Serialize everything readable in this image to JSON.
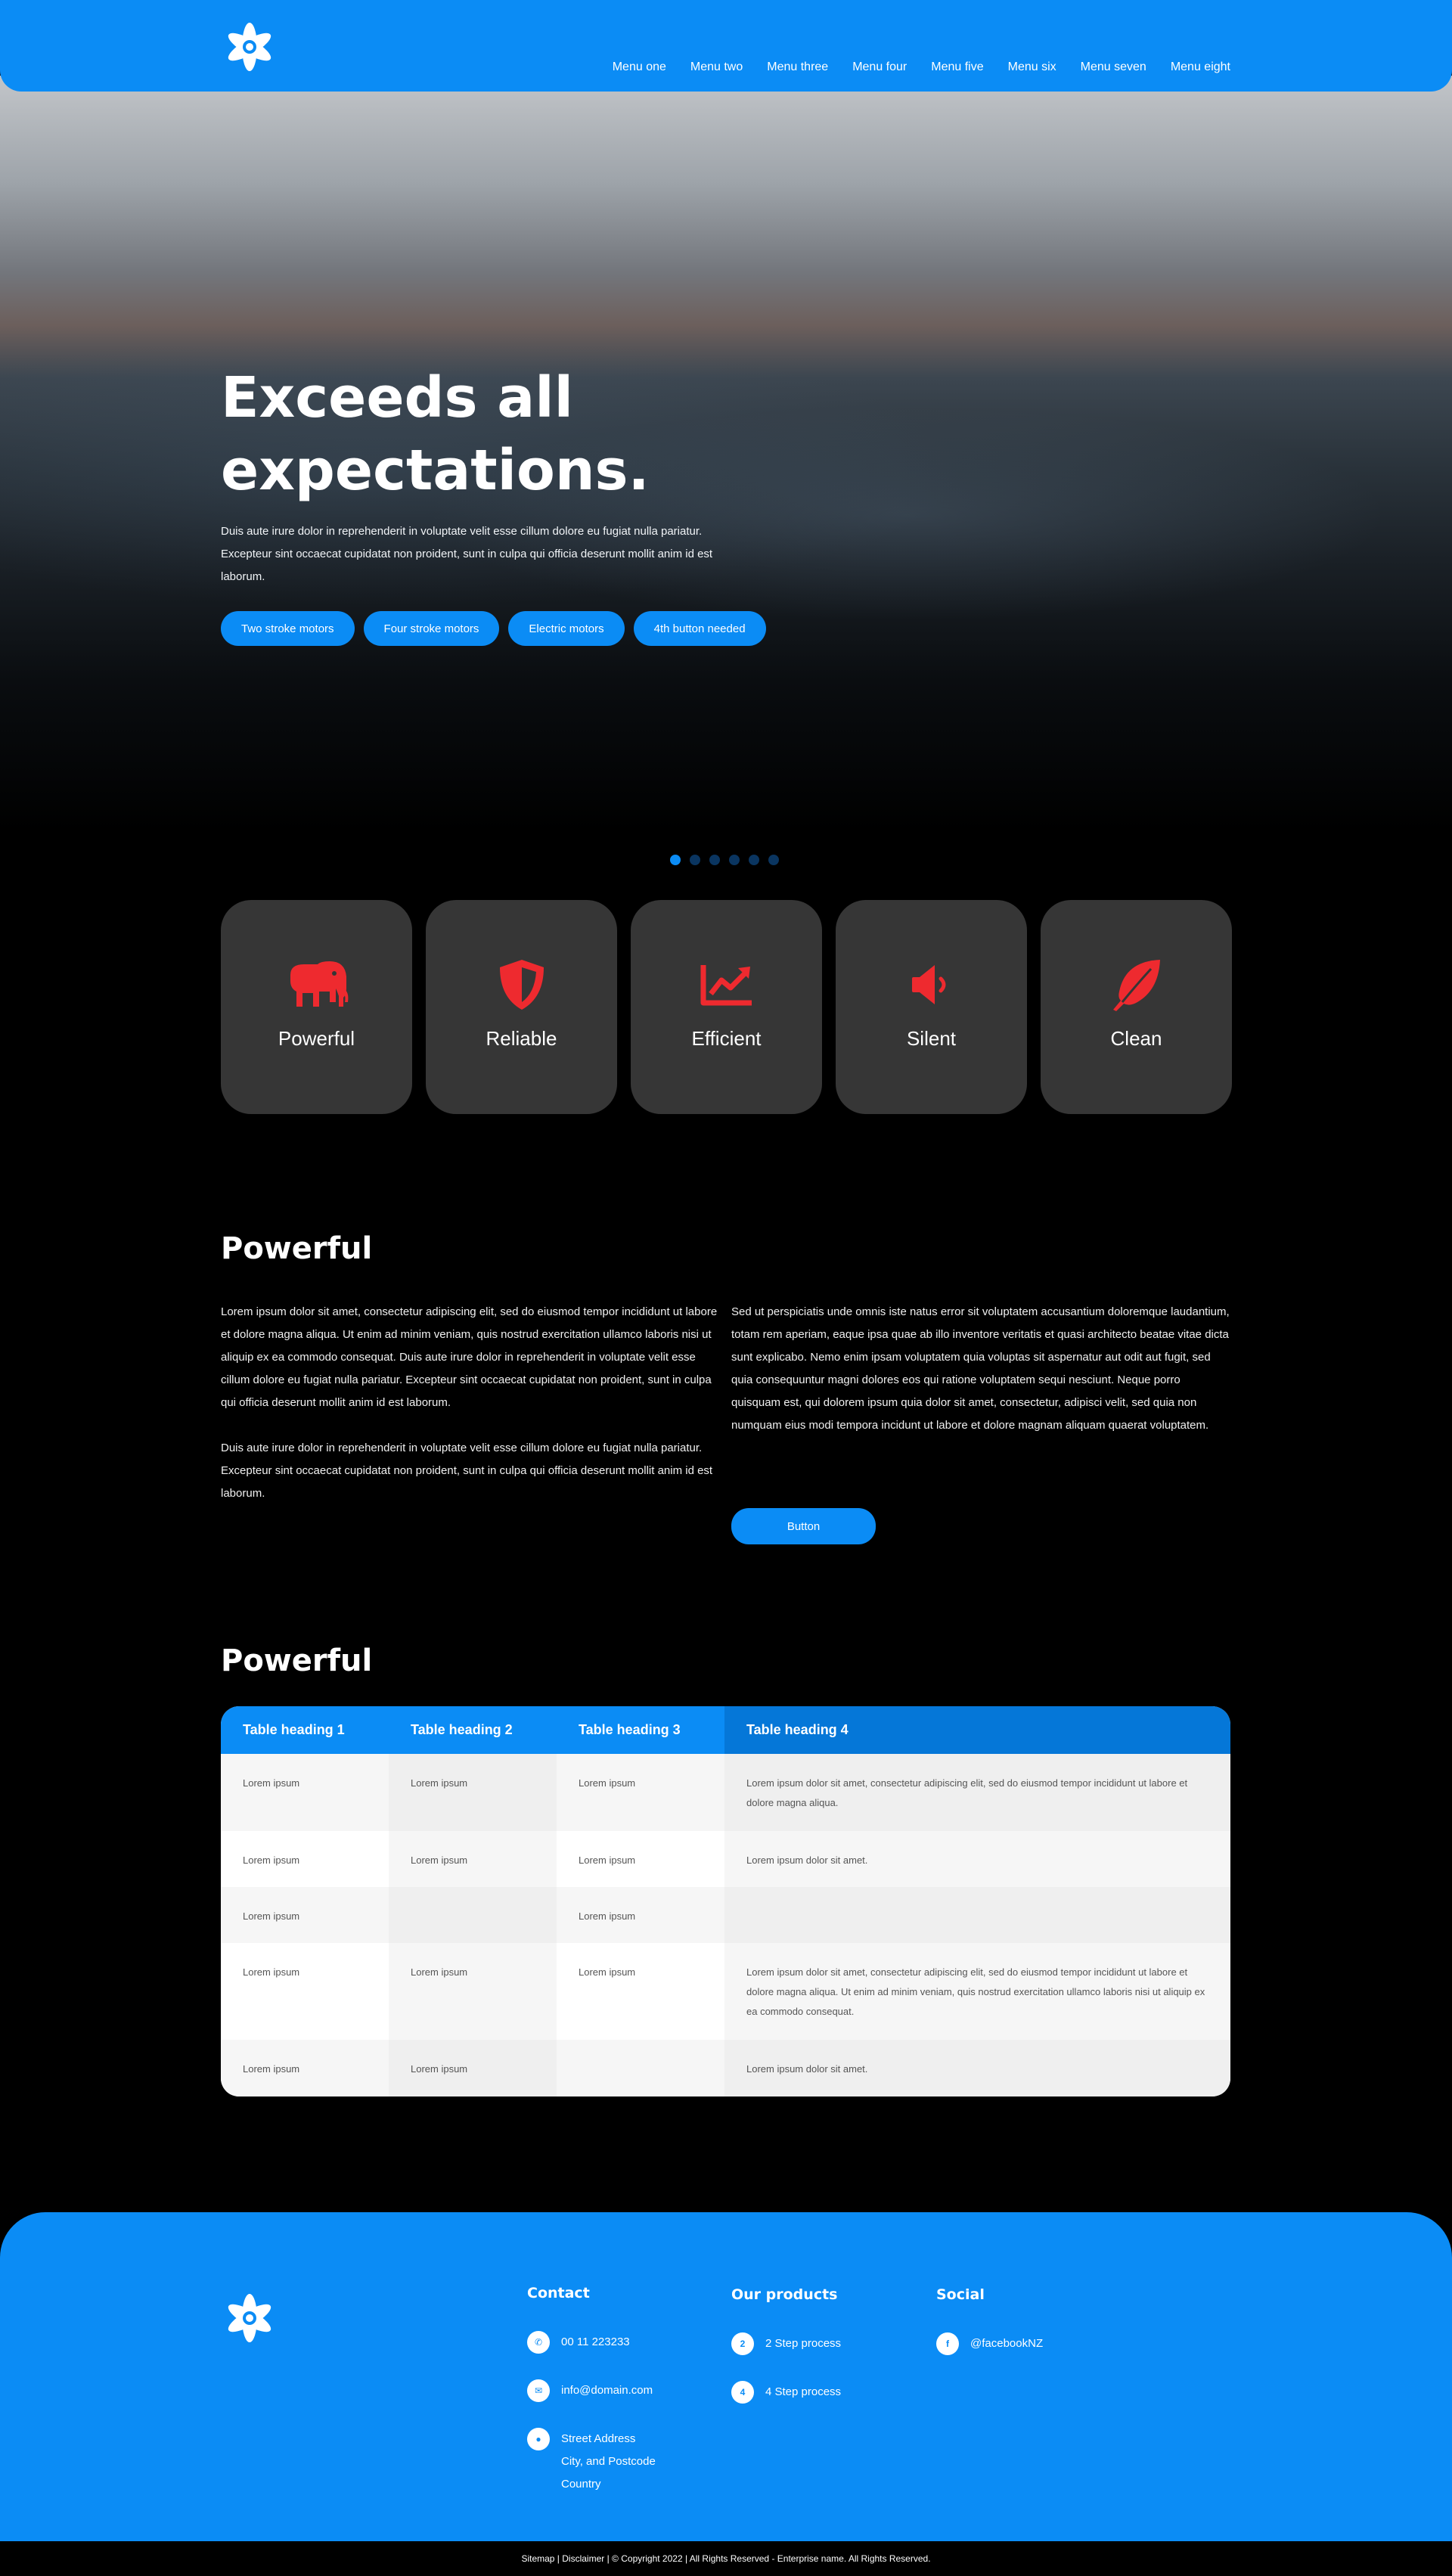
{
  "brand": {
    "accent": "#0b8cf5",
    "icon_accent": "#ee2a2f",
    "logo_icon": "atom-flower-logo"
  },
  "nav": [
    "Menu one",
    "Menu two",
    "Menu three",
    "Menu four",
    "Menu five",
    "Menu six",
    "Menu seven",
    "Menu eight"
  ],
  "hero": {
    "title_line1": "Exceeds all",
    "title_line2": "expectations.",
    "text": "Duis aute irure dolor in reprehenderit in voluptate velit esse cillum dolore eu fugiat nulla pariatur. Excepteur sint occaecat cupidatat non proident, sunt in culpa qui officia deserunt mollit anim id est laborum.",
    "buttons": [
      "Two stroke motors",
      "Four stroke motors",
      "Electric motors",
      "4th button needed"
    ],
    "carousel_slides": 6,
    "carousel_active": 1
  },
  "features": [
    {
      "label": "Powerful",
      "icon": "elephant-icon"
    },
    {
      "label": "Reliable",
      "icon": "shield-icon"
    },
    {
      "label": "Efficient",
      "icon": "chart-line-icon"
    },
    {
      "label": "Silent",
      "icon": "speaker-icon"
    },
    {
      "label": "Clean",
      "icon": "leaf-icon"
    }
  ],
  "section1": {
    "title": "Powerful",
    "left_p1": "Lorem ipsum dolor sit amet, consectetur adipiscing elit, sed do eiusmod tempor incididunt ut labore et dolore magna aliqua. Ut enim ad minim veniam, quis nostrud exercitation ullamco laboris nisi ut aliquip ex ea commodo consequat. Duis aute irure dolor in reprehenderit in voluptate velit esse cillum dolore eu fugiat nulla pariatur. Excepteur sint occaecat cupidatat non proident, sunt in culpa qui officia deserunt mollit anim id est laborum.",
    "left_p2": "Duis aute irure dolor in reprehenderit in voluptate velit esse cillum dolore eu fugiat nulla pariatur. Excepteur sint occaecat cupidatat non proident, sunt in culpa qui officia deserunt mollit anim id est laborum.",
    "right_p1": "Sed ut perspiciatis unde omnis iste natus error sit voluptatem accusantium doloremque laudantium, totam rem aperiam, eaque ipsa quae ab illo inventore veritatis et quasi architecto beatae vitae dicta sunt explicabo. Nemo enim ipsam voluptatem quia voluptas sit aspernatur aut odit aut fugit, sed quia consequuntur magni dolores eos qui ratione voluptatem sequi nesciunt. Neque porro quisquam est, qui dolorem ipsum quia dolor sit amet, consectetur, adipisci velit, sed quia non numquam eius modi tempora incidunt ut labore et dolore magnam aliquam quaerat voluptatem.",
    "button": "Button"
  },
  "section2": {
    "title": "Powerful",
    "headers": [
      "Table heading 1",
      "Table heading 2",
      "Table heading 3",
      "Table heading 4"
    ],
    "rows": [
      [
        "Lorem ipsum",
        "Lorem ipsum",
        "Lorem ipsum",
        "Lorem ipsum dolor sit amet, consectetur adipiscing elit, sed do eiusmod tempor incididunt ut labore et dolore magna aliqua."
      ],
      [
        "Lorem ipsum",
        "Lorem ipsum",
        "Lorem ipsum",
        "Lorem ipsum dolor sit amet."
      ],
      [
        "Lorem ipsum",
        "",
        "Lorem ipsum",
        ""
      ],
      [
        "Lorem ipsum",
        "Lorem ipsum",
        "Lorem ipsum",
        "Lorem ipsum dolor sit amet, consectetur adipiscing elit, sed do eiusmod tempor incididunt ut labore et dolore magna aliqua. Ut enim ad minim veniam, quis nostrud exercitation ullamco laboris nisi ut aliquip ex ea commodo consequat."
      ],
      [
        "Lorem ipsum",
        "Lorem ipsum",
        "",
        "Lorem ipsum dolor sit amet."
      ]
    ]
  },
  "footer": {
    "contact_title": "Contact",
    "phone": "00 11 223233",
    "email": "info@domain.com",
    "address_line1": "Street Address",
    "address_line2": "City, and Postcode",
    "address_line3": "Country",
    "products_title": "Our products",
    "product1_num": "2",
    "product1": "2 Step process",
    "product2_num": "4",
    "product2": "4 Step process",
    "social_title": "Social",
    "facebook": "@facebookNZ",
    "copyright": "Sitemap | Disclaimer | © Copyright 2022 | All Rights Reserved - Enterprise name. All Rights Reserved."
  }
}
